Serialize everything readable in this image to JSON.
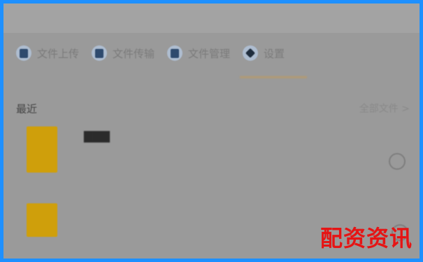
{
  "toolbar": {
    "items": [
      {
        "label": "文件上传",
        "icon": "document-icon"
      },
      {
        "label": "文件传输",
        "icon": "transfer-icon"
      },
      {
        "label": "文件管理",
        "icon": "folder-icon"
      },
      {
        "label": "设置",
        "icon": "settings-icon"
      }
    ]
  },
  "recent": {
    "title": "最近",
    "action": "全部文件 >"
  },
  "files": [
    {
      "name": "▇▇▇",
      "meta": "",
      "selected": false
    },
    {
      "name": "",
      "meta": "",
      "selected": false
    }
  ],
  "watermark": "配资资讯",
  "colors": {
    "frame_border": "#1e90ff",
    "file_icon": "#cf9f0b",
    "watermark": "#e61414"
  }
}
